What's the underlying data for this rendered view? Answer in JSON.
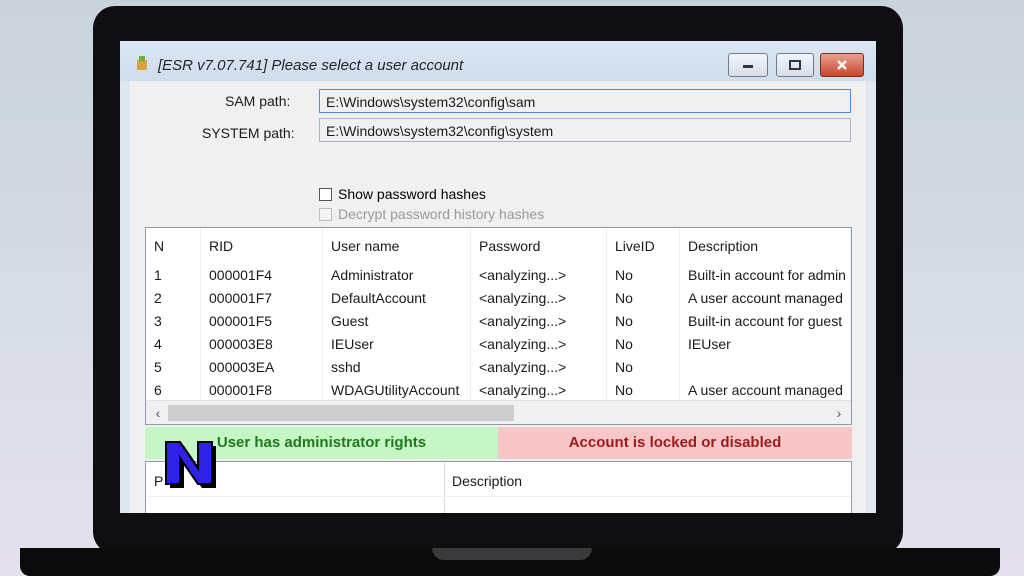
{
  "window": {
    "title": "[ESR v7.07.741]  Please select a user account"
  },
  "form": {
    "sam_label": "SAM path:",
    "sam_value": "E:\\Windows\\system32\\config\\sam",
    "system_label": "SYSTEM path:",
    "system_value": "E:\\Windows\\system32\\config\\system",
    "show_hashes_label": "Show password hashes",
    "decrypt_history_label": "Decrypt password history hashes"
  },
  "table": {
    "columns": [
      "N",
      "RID",
      "User name",
      "Password",
      "LiveID",
      "Description"
    ],
    "rows": [
      [
        "1",
        "000001F4",
        "Administrator",
        "<analyzing...>",
        "No",
        "Built-in account for admin"
      ],
      [
        "2",
        "000001F7",
        "DefaultAccount",
        "<analyzing...>",
        "No",
        "A user account managed"
      ],
      [
        "3",
        "000001F5",
        "Guest",
        "<analyzing...>",
        "No",
        "Built-in account for guest"
      ],
      [
        "4",
        "000003E8",
        "IEUser",
        "<analyzing...>",
        "No",
        "IEUser"
      ],
      [
        "5",
        "000003EA",
        "sshd",
        "<analyzing...>",
        "No",
        ""
      ],
      [
        "6",
        "000001F8",
        "WDAGUtilityAccount",
        "<analyzing...>",
        "No",
        "A user account managed"
      ]
    ]
  },
  "legend": {
    "admin": "User has administrator rights",
    "locked": "Account is locked or disabled"
  },
  "lower_table": {
    "columns": [
      "P",
      "Description"
    ]
  },
  "colors": {
    "admin_bg": "#c6f5c6",
    "admin_fg": "#1d7a1d",
    "locked_bg": "#f8c6c6",
    "locked_fg": "#9b1c1c",
    "logo": "#2f21e6"
  },
  "icons": [
    "app-icon",
    "minimize-icon",
    "maximize-icon",
    "close-icon",
    "scroll-left-icon",
    "scroll-right-icon",
    "logo-n-icon"
  ]
}
